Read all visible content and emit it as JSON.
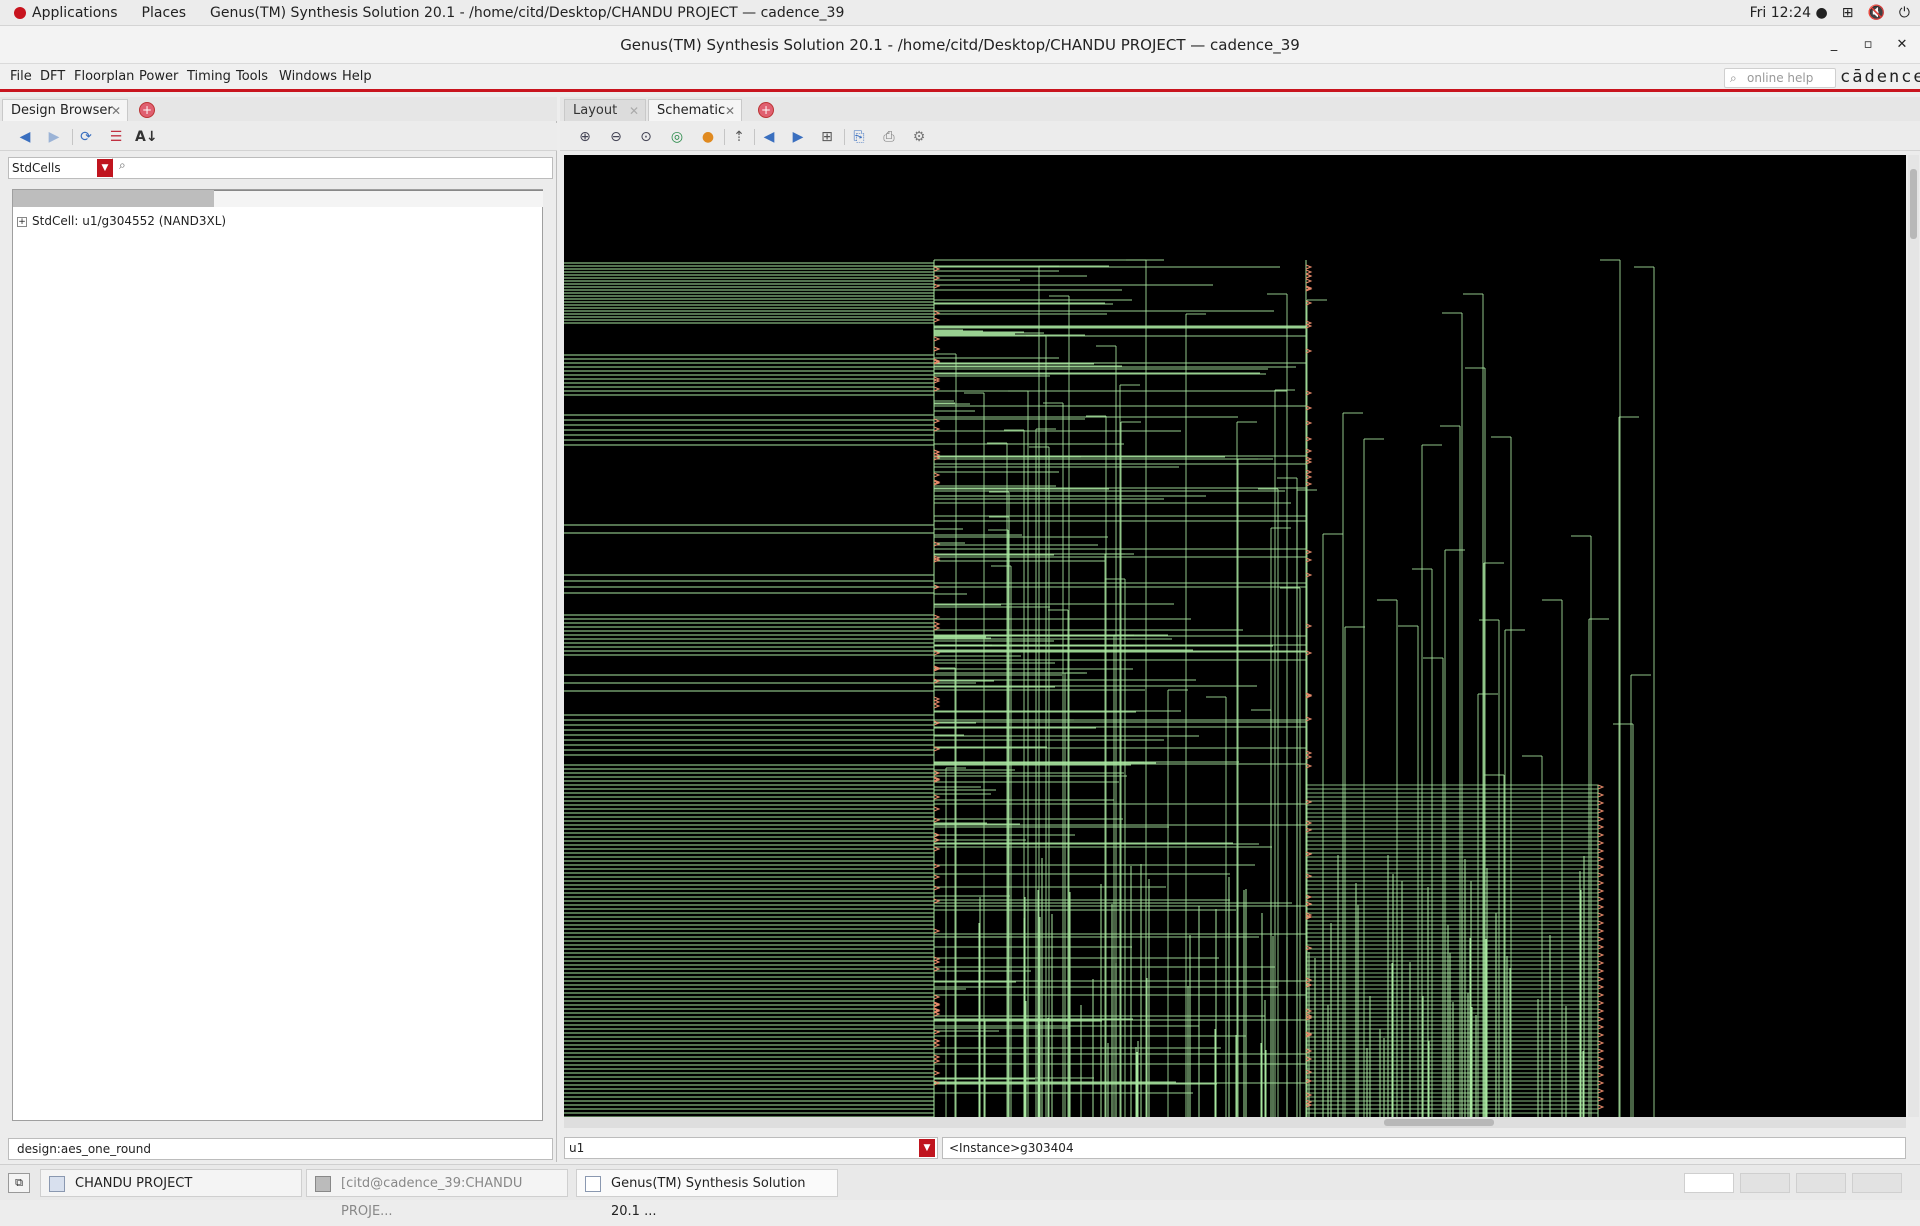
{
  "topbar": {
    "applications": "Applications",
    "places": "Places",
    "window_title": "Genus(TM) Synthesis Solution 20.1 - /home/citd/Desktop/CHANDU PROJECT — cadence_39",
    "clock": "Fri 12:24 ●"
  },
  "window": {
    "title": "Genus(TM) Synthesis Solution 20.1 - /home/citd/Desktop/CHANDU PROJECT — cadence_39",
    "minimize": "_",
    "maximize": "▫",
    "close": "✕"
  },
  "menu": {
    "items": [
      "File",
      "DFT",
      "Floorplan",
      "Power",
      "Timing",
      "Tools",
      "Windows",
      "Help"
    ],
    "search_placeholder": "online help",
    "logo": "cādence"
  },
  "left_panel": {
    "tab_label": "Design Browser",
    "filter_select": "StdCells",
    "tree_row": "StdCell: u1/g304552 (NAND3XL)",
    "status": "design:aes_one_round"
  },
  "right_panel": {
    "tabs": [
      "Layout",
      "Schematic"
    ],
    "active_tab": "Schematic",
    "status_left": "u1",
    "status_right": "<Instance>g303404"
  },
  "taskbar": {
    "items": [
      "CHANDU PROJECT",
      "[citd@cadence_39:CHANDU PROJE...",
      "Genus(TM) Synthesis Solution 20.1 ..."
    ]
  },
  "colors": {
    "accent_red": "#c8141e",
    "schematic_bg": "#000000",
    "wire": "#a8e6a0",
    "pin": "#e88a6a"
  },
  "icons": {
    "left_toolbar": [
      "back-arrow-icon",
      "forward-arrow-icon",
      "refresh-icon",
      "hierarchy-icon",
      "sort-az-icon"
    ],
    "right_toolbar": [
      "zoom-in-icon",
      "zoom-out-icon",
      "zoom-fit-icon",
      "zoom-area-icon",
      "stop-icon",
      "up-hierarchy-icon",
      "back-icon",
      "forward-icon",
      "layout-icon",
      "export-icon",
      "print-icon",
      "settings-icon"
    ]
  }
}
